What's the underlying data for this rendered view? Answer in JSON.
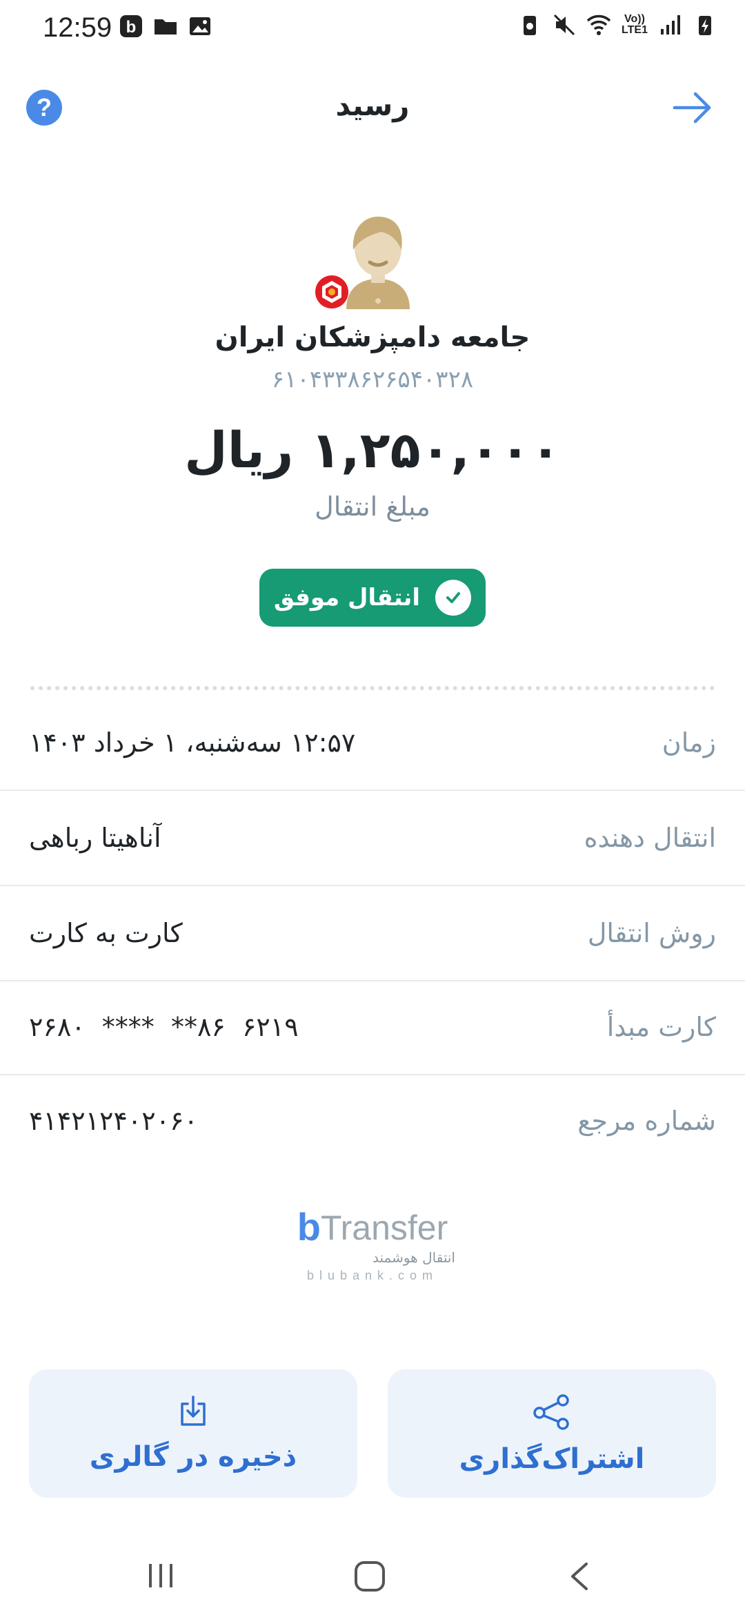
{
  "status_bar": {
    "time": "12:59",
    "network_label": "Vo)) LTE1"
  },
  "header": {
    "title": "رسید",
    "help_label": "?"
  },
  "recipient": {
    "name": "جامعه دامپزشکان ایران",
    "card_number": "۶۱۰۴۳۳۸۶۲۶۵۴۰۳۲۸"
  },
  "amount": {
    "value": "۱,۲۵۰,۰۰۰ ریال",
    "label": "مبلغ انتقال"
  },
  "status": {
    "label": "انتقال موفق",
    "color": "#169b75"
  },
  "details": [
    {
      "label": "زمان",
      "value": "۱۲:۵۷ سه‌شنبه، ۱ خرداد ۱۴۰۳"
    },
    {
      "label": "انتقال دهنده",
      "value": "آناهیتا رباهی"
    },
    {
      "label": "روش انتقال",
      "value": "کارت به کارت"
    },
    {
      "label": "کارت مبدأ",
      "value": "۶۲۱۹  ۸۶**  ****  ۲۶۸۰"
    },
    {
      "label": "شماره مرجع",
      "value": "۴۱۴۲۱۲۴۰۲۰۶۰"
    }
  ],
  "brand": {
    "name": "bTransfer",
    "tagline": "انتقال هوشمند",
    "domain": "blubank.com"
  },
  "actions": {
    "save_label": "ذخیره در گالری",
    "share_label": "اشتراک‌گذاری"
  },
  "colors": {
    "accent": "#2e6fd0",
    "help": "#4a8ae6",
    "button_bg": "#edf3fb"
  }
}
